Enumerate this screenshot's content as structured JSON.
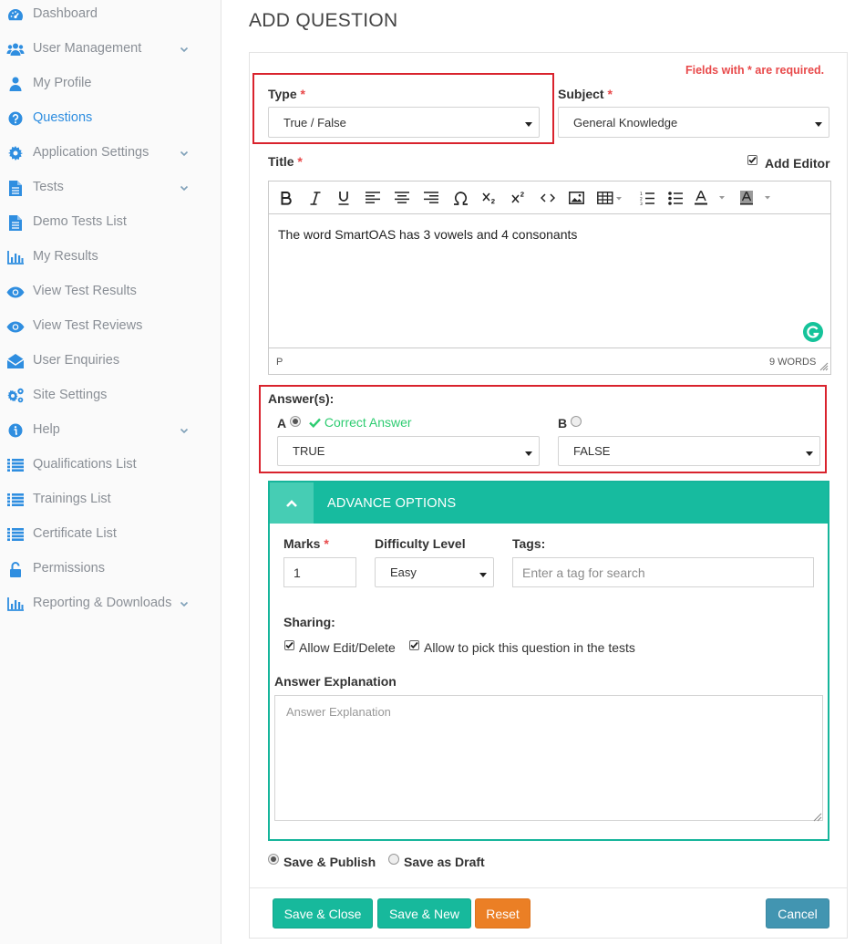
{
  "sidebar": {
    "items": [
      {
        "label": "Dashboard",
        "icon": "dashboard-icon",
        "has_chevron": false,
        "active": false
      },
      {
        "label": "User Management",
        "icon": "users-icon",
        "has_chevron": true,
        "active": false
      },
      {
        "label": "My Profile",
        "icon": "user-icon",
        "has_chevron": false,
        "active": false
      },
      {
        "label": "Questions",
        "icon": "question-circle-icon",
        "has_chevron": false,
        "active": true
      },
      {
        "label": "Application Settings",
        "icon": "gear-icon",
        "has_chevron": true,
        "active": false
      },
      {
        "label": "Tests",
        "icon": "file-text-icon",
        "has_chevron": true,
        "active": false
      },
      {
        "label": "Demo Tests List",
        "icon": "file-text-icon",
        "has_chevron": false,
        "active": false
      },
      {
        "label": "My Results",
        "icon": "bar-chart-icon",
        "has_chevron": false,
        "active": false
      },
      {
        "label": "View Test Results",
        "icon": "eye-icon",
        "has_chevron": false,
        "active": false
      },
      {
        "label": "View Test Reviews",
        "icon": "eye-icon",
        "has_chevron": false,
        "active": false
      },
      {
        "label": "User Enquiries",
        "icon": "envelope-open-icon",
        "has_chevron": false,
        "active": false
      },
      {
        "label": "Site Settings",
        "icon": "cogs-icon",
        "has_chevron": false,
        "active": false
      },
      {
        "label": "Help",
        "icon": "info-circle-icon",
        "has_chevron": true,
        "active": false
      },
      {
        "label": "Qualifications List",
        "icon": "list-icon",
        "has_chevron": false,
        "active": false
      },
      {
        "label": "Trainings List",
        "icon": "list-icon",
        "has_chevron": false,
        "active": false
      },
      {
        "label": "Certificate List",
        "icon": "list-icon",
        "has_chevron": false,
        "active": false
      },
      {
        "label": "Permissions",
        "icon": "unlock-icon",
        "has_chevron": false,
        "active": false
      },
      {
        "label": "Reporting & Downloads",
        "icon": "bar-chart-icon",
        "has_chevron": true,
        "active": false
      }
    ]
  },
  "page": {
    "title": "ADD QUESTION",
    "required_note": "Fields with * are required."
  },
  "form": {
    "type": {
      "label": "Type",
      "required_mark": "*",
      "value": "True / False"
    },
    "subject": {
      "label": "Subject",
      "required_mark": "*",
      "value": "General Knowledge"
    },
    "title": {
      "label": "Title",
      "required_mark": "*",
      "add_editor_label": "Add Editor",
      "add_editor_checked": true
    },
    "editor": {
      "content": "The word SmartOAS has 3 vowels and 4 consonants",
      "status_path": "P",
      "word_count": "9 WORDS"
    },
    "answers": {
      "label": "Answer(s):",
      "a": {
        "letter": "A",
        "correct_label": "Correct Answer",
        "value": "TRUE",
        "selected": true
      },
      "b": {
        "letter": "B",
        "value": "FALSE",
        "selected": false
      }
    },
    "advance": {
      "title": "ADVANCE OPTIONS",
      "marks": {
        "label": "Marks",
        "required_mark": "*",
        "value": "1"
      },
      "difficulty": {
        "label": "Difficulty Level",
        "value": "Easy"
      },
      "tags": {
        "label": "Tags:",
        "placeholder": "Enter a tag for search"
      },
      "sharing": {
        "label": "Sharing:",
        "allow_edit": "Allow Edit/Delete",
        "allow_pick": "Allow to pick this question in the tests"
      },
      "explanation": {
        "label": "Answer Explanation",
        "placeholder": "Answer Explanation"
      }
    },
    "publish": {
      "save_publish": "Save & Publish",
      "save_draft": "Save as Draft",
      "selected": "publish"
    }
  },
  "buttons": {
    "save_close": "Save & Close",
    "save_new": "Save & New",
    "reset": "Reset",
    "cancel": "Cancel"
  },
  "colors": {
    "accent_teal": "#17bb9f",
    "link_blue": "#2f8ee0",
    "required_red": "#e8494a",
    "highlight_red": "#d9232d",
    "reset_orange": "#eb7f25",
    "cancel_blue": "#4295b1",
    "correct_green": "#2ecc71"
  }
}
